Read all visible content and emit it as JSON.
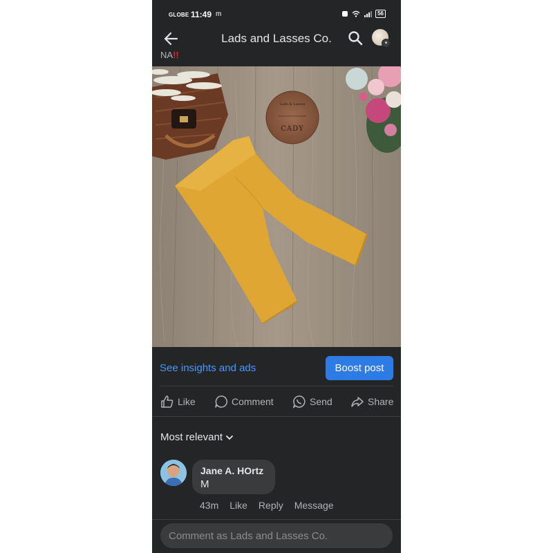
{
  "status_bar": {
    "carrier": "GLOBE",
    "time": "11:49",
    "indicators": "m",
    "battery": "56"
  },
  "header": {
    "title": "Lads and Lasses Co."
  },
  "post": {
    "caption_partial": "NA",
    "caption_marks": "!!",
    "photo_sign_text": "CADY"
  },
  "promo": {
    "insights_link": "See insights and ads",
    "boost_button": "Boost post"
  },
  "actions": {
    "like": "Like",
    "comment": "Comment",
    "send": "Send",
    "share": "Share"
  },
  "comments": {
    "sort_label": "Most relevant",
    "items": [
      {
        "author": "Jane A. HOrtz",
        "text": "M",
        "time": "43m",
        "like": "Like",
        "reply": "Reply",
        "message": "Message"
      }
    ]
  },
  "composer": {
    "placeholder": "Comment as Lads and Lasses Co."
  },
  "colors": {
    "background": "#242526",
    "link": "#4599ff",
    "boost": "#2d7be5",
    "pants": "#dfa633"
  }
}
